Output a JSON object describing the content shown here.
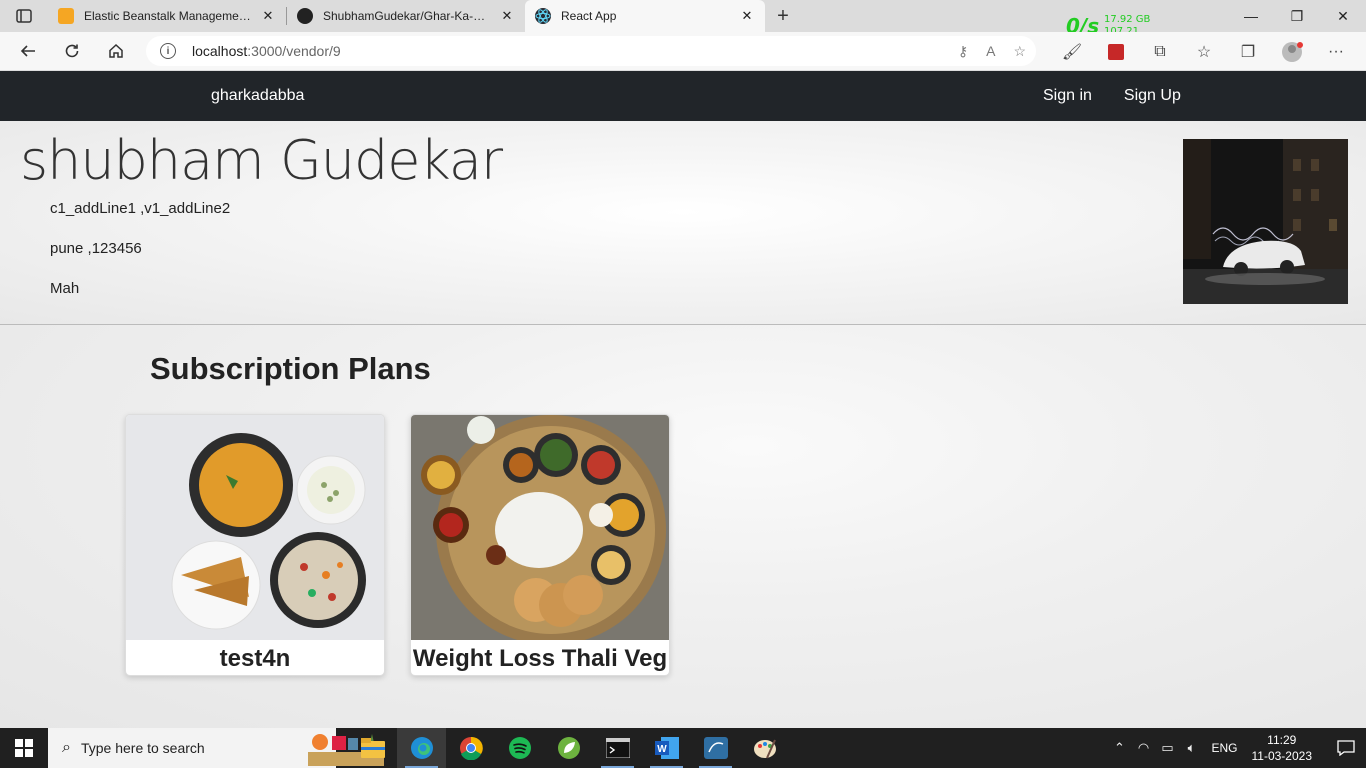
{
  "browser": {
    "tabs": [
      {
        "title": "Elastic Beanstalk Management Co",
        "favicon_color": "#f5a623"
      },
      {
        "title": "ShubhamGudekar/Ghar-Ka-Dabba",
        "favicon_color": "#222222"
      },
      {
        "title": "React App",
        "favicon_color": "#282c34"
      }
    ],
    "active_tab": 2,
    "url_host": "localhost",
    "url_path": ":3000/vendor/9",
    "net_monitor": {
      "speed": "0/s",
      "line1": "17.92 GB",
      "line2": "107.21"
    }
  },
  "navbar": {
    "brand": "gharkadabba",
    "sign_in": "Sign in",
    "sign_up": "Sign Up"
  },
  "vendor": {
    "name": "shubham Gudekar",
    "address_line": "c1_addLine1 ,v1_addLine2",
    "city_pin": "pune ,123456",
    "state": "Mah"
  },
  "plans": {
    "title": "Subscription Plans",
    "items": [
      {
        "name": "test4n"
      },
      {
        "name": "Weight Loss Thali Veg"
      }
    ]
  },
  "taskbar": {
    "search_placeholder": "Type here to search",
    "language": "ENG",
    "time": "11:29",
    "date": "11-03-2023"
  }
}
